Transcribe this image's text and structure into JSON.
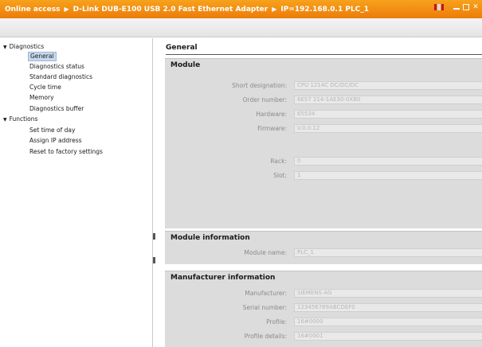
{
  "titlebar": {
    "crumbs": [
      "Online access",
      "D-Link DUB-E100 USB 2.0 Fast Ethernet Adapter",
      "IP=192.168.0.1 PLC_1"
    ]
  },
  "nav": {
    "diagnostics": "Diagnostics",
    "general": "General",
    "diagnostics_status": "Diagnostics status",
    "standard_diagnostics": "Standard diagnostics",
    "cycle_time": "Cycle time",
    "memory": "Memory",
    "diagnostics_buffer": "Diagnostics buffer",
    "functions": "Functions",
    "set_time": "Set time of day",
    "assign_ip": "Assign IP address",
    "reset_factory": "Reset to factory settings"
  },
  "content": {
    "heading": "General",
    "module": {
      "title": "Module",
      "short_designation_label": "Short designation:",
      "short_designation": "CPU 1214C DC/DC/DC",
      "order_number_label": "Order number:",
      "order_number": "6ES7 214-1AE30-0XB0",
      "hardware_label": "Hardware:",
      "hardware": "65534",
      "firmware_label": "Firmware:",
      "firmware": "V.0.0.12",
      "rack_label": "Rack:",
      "rack": "0",
      "slot_label": "Slot:",
      "slot": "1"
    },
    "module_info": {
      "title": "Module information",
      "module_name_label": "Module name:",
      "module_name": "PLC_1"
    },
    "manufacturer": {
      "title": "Manufacturer information",
      "manufacturer_label": "Manufacturer:",
      "manufacturer": "SIEMENS AG",
      "serial_label": "Serial number:",
      "serial": "123456789ABCDEF0",
      "profile_label": "Profile:",
      "profile": "16#0000",
      "profile_details_label": "Profile details:",
      "profile_details": "16#0001"
    }
  },
  "colors": {
    "title_bar": "#ec7c0a",
    "selection": "#c7d9ee",
    "section_bg": "#dcdcdc"
  }
}
